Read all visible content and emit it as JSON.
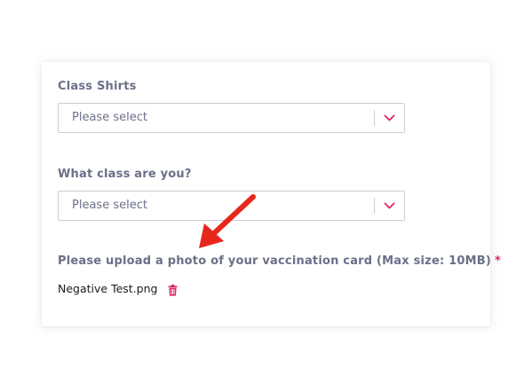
{
  "form": {
    "shirts": {
      "label": "Class Shirts",
      "value": "Please select",
      "icon": "chevron-down-icon"
    },
    "class_year": {
      "label": "What class are you?",
      "value": "Please select",
      "icon": "chevron-down-icon"
    },
    "upload": {
      "label": "Please upload a photo of your vaccination card (Max size: 10MB)",
      "required_mark": "*",
      "file_name": "Negative Test.png",
      "delete_icon": "trash-icon"
    }
  },
  "annotation": {
    "icon": "arrow-icon",
    "color": "#e8261c"
  },
  "colors": {
    "label": "#6b6f88",
    "accent": "#e0245e",
    "border": "#c9ccd6"
  }
}
